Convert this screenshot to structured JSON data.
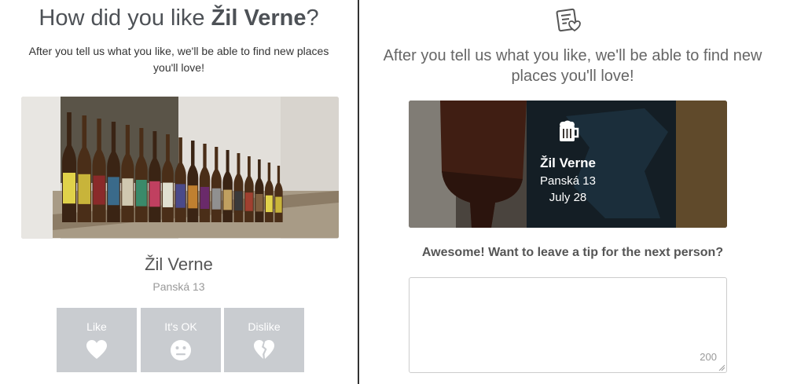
{
  "left": {
    "title_prefix": "How did you like ",
    "title_venue": "Žil Verne",
    "title_suffix": "?",
    "subtitle": "After you tell us what you like, we'll be able to find new places you'll love!",
    "venue_name": "Žil Verne",
    "venue_address": "Panská 13",
    "buttons": [
      {
        "label": "Like",
        "icon": "heart-icon"
      },
      {
        "label": "It's OK",
        "icon": "neutral-face-icon"
      },
      {
        "label": "Dislike",
        "icon": "broken-heart-icon"
      }
    ]
  },
  "right": {
    "top_icon": "checklist-heart-icon",
    "subtitle": "After you tell us what you like, we'll be able to find new places you'll love!",
    "card": {
      "icon": "beer-mug-icon",
      "venue_name": "Žil Verne",
      "venue_address": "Panská 13",
      "date": "July 28"
    },
    "tip_question": "Awesome! Want to leave a tip for the next person?",
    "tip_counter": "200"
  },
  "colors": {
    "button_bg": "#c9ccd0",
    "text_dark": "#4d5156",
    "text_muted": "#999999"
  }
}
